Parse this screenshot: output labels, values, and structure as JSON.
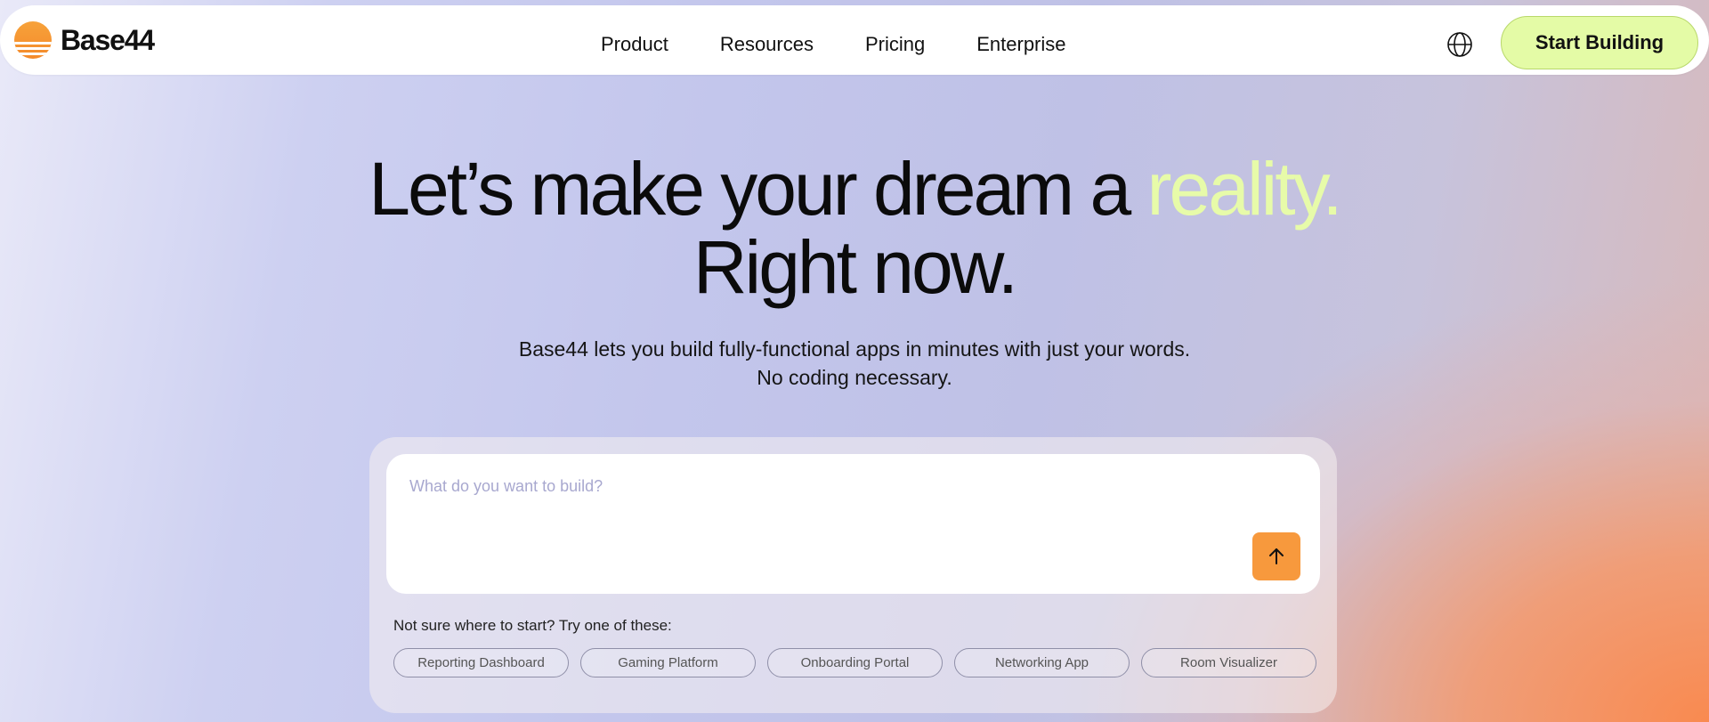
{
  "header": {
    "logo_text": "Base44",
    "logo_icon": "sun-logo-icon",
    "nav": [
      "Product",
      "Resources",
      "Pricing",
      "Enterprise"
    ],
    "language_icon": "globe-icon",
    "cta_label": "Start Building"
  },
  "hero": {
    "headline_part1": "Let’s make your dream a ",
    "headline_accent": "reality.",
    "headline_line2": "Right now.",
    "subtext_line1": "Base44 lets you build fully-functional apps in minutes with just your words.",
    "subtext_line2": "No coding necessary."
  },
  "prompt": {
    "placeholder": "What do you want to build?",
    "send_icon": "arrow-up-icon",
    "hint": "Not sure where to start? Try one of these:",
    "suggestions": [
      "Reporting Dashboard",
      "Gaming Platform",
      "Onboarding Portal",
      "Networking App",
      "Room Visualizer"
    ]
  },
  "colors": {
    "accent_green": "#e4fba6",
    "accent_orange": "#f7993d",
    "reality_text": "#e7fba9"
  }
}
